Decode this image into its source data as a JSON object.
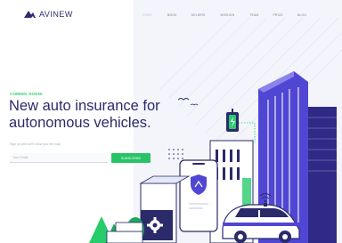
{
  "brand": {
    "name": "AVINEW",
    "logo_color": "#2c2c6e"
  },
  "nav": {
    "items": [
      {
        "label": "HOME",
        "active": true
      },
      {
        "label": "BOOK"
      },
      {
        "label": "DELIERS"
      },
      {
        "label": "MISSION"
      },
      {
        "label": "TEAM"
      },
      {
        "label": "PRICE"
      },
      {
        "label": "BLOG"
      }
    ]
  },
  "hero": {
    "eyebrow": "COMING SOON!",
    "headline_line1": "New auto insurance for",
    "headline_line2": "autonomous vehicles.",
    "subtext": "Sign up and we'll show you the way."
  },
  "form": {
    "email_placeholder": "Your Email",
    "subscribe_label": "SUBSCRIBE"
  },
  "colors": {
    "accent_green": "#27c467",
    "navy": "#2b2a6b",
    "building_blue": "#5046d4",
    "sky_tint": "#eef1fa"
  },
  "icons": {
    "logo": "logo-chevron-icon",
    "shield": "shield-icon",
    "gear": "gear-icon",
    "wifi": "wifi-icon",
    "battery": "battery-bolt-icon"
  }
}
